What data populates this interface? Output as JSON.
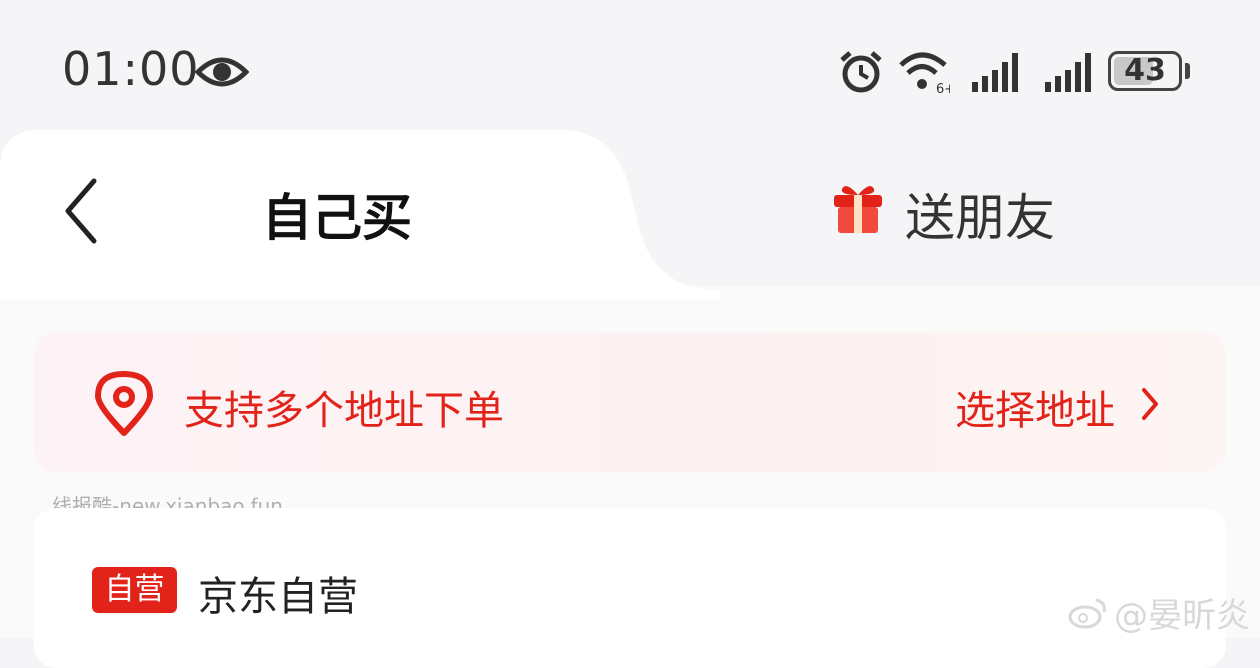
{
  "status_bar": {
    "time": "01:00",
    "battery_level": "43",
    "icons": [
      "eye-icon",
      "alarm-icon",
      "wifi-icon",
      "signal-icon",
      "signal-icon",
      "battery-icon"
    ]
  },
  "tabs": [
    {
      "label": "自己买",
      "active": true
    },
    {
      "label": "送朋友",
      "active": false,
      "icon": "gift-icon"
    }
  ],
  "address_banner": {
    "text": "支持多个地址下单",
    "action_label": "选择地址",
    "icon": "location-pin-icon"
  },
  "watermark_source": "线报酷-new.xianbao.fun",
  "store": {
    "badge": "自营",
    "name": "京东自营"
  },
  "weibo_watermark": "@晏昕炎",
  "colors": {
    "accent": "#e2231a",
    "background": "#f5f5f7"
  }
}
